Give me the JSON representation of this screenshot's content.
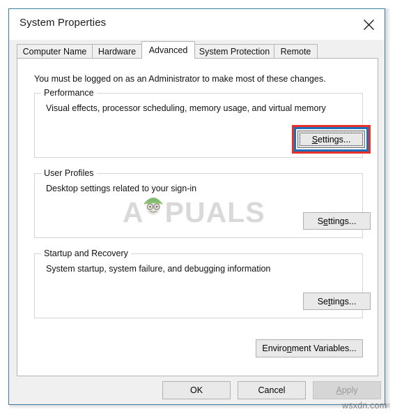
{
  "window": {
    "title": "System Properties",
    "close_icon": "close-icon",
    "border_color": "#3c7d9e"
  },
  "tabs": [
    {
      "label": "Computer Name",
      "active": false
    },
    {
      "label": "Hardware",
      "active": false
    },
    {
      "label": "Advanced",
      "active": true
    },
    {
      "label": "System Protection",
      "active": false
    },
    {
      "label": "Remote",
      "active": false
    }
  ],
  "panel": {
    "admin_note": "You must be logged on as an Administrator to make most of these changes.",
    "groups": [
      {
        "label": "Performance",
        "description": "Visual effects, processor scheduling, memory usage, and virtual memory",
        "button": {
          "label_before": "S",
          "label_accel": "",
          "label_after": "ettings...",
          "full_label": "Settings...",
          "accel_char": "S",
          "focused": true,
          "highlighted": true
        }
      },
      {
        "label": "User Profiles",
        "description": "Desktop settings related to your sign-in",
        "button": {
          "label_before": "S",
          "label_accel": "e",
          "label_after": "ttings...",
          "full_label": "Settings...",
          "accel_char": "e",
          "focused": false,
          "highlighted": false
        }
      },
      {
        "label": "Startup and Recovery",
        "description": "System startup, system failure, and debugging information",
        "button": {
          "label_before": "Se",
          "label_accel": "t",
          "label_after": "tings...",
          "full_label": "Settings...",
          "accel_char": "t",
          "focused": false,
          "highlighted": false
        }
      }
    ],
    "environment_button": {
      "label_before": "Enviro",
      "label_accel": "n",
      "label_after": "ment Variables...",
      "full_label": "Environment Variables...",
      "accel_char": "n"
    }
  },
  "footer": {
    "ok": {
      "label": "OK",
      "enabled": true
    },
    "cancel": {
      "label": "Cancel",
      "enabled": true
    },
    "apply": {
      "label_before": "",
      "label_accel": "A",
      "label_after": "pply",
      "full_label": "Apply",
      "accel_char": "A",
      "enabled": false
    }
  },
  "watermarks": {
    "appuals_before": "A",
    "appuals_after": "PUALS",
    "appuals_full": "APPUALS",
    "mascot_icon": "appuals-mascot-icon",
    "source": "wsxdn.com"
  },
  "annotation": {
    "red_color": "#e8312a",
    "blue_color": "#1d70b8"
  }
}
